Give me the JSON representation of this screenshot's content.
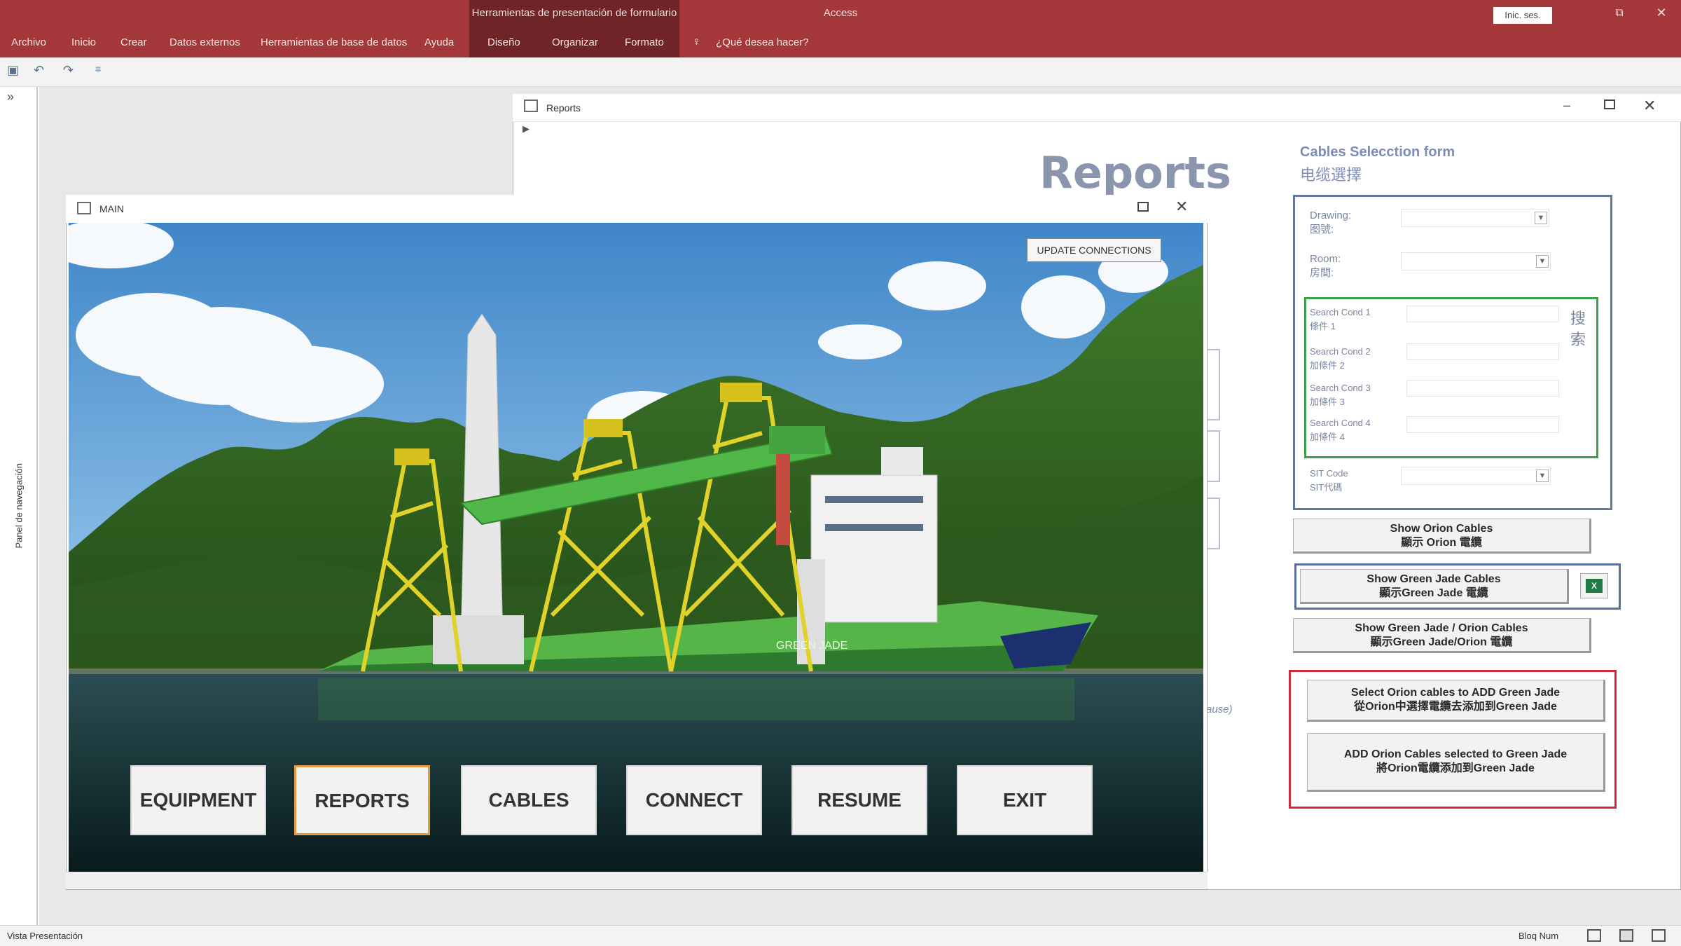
{
  "ribbon": {
    "context_header": "Herramientas de presentación de formulario",
    "app_title": "Access",
    "signin_label": "Inic. ses.",
    "tabs": [
      "Archivo",
      "Inicio",
      "Crear",
      "Datos externos",
      "Herramientas de base de datos",
      "Ayuda",
      "Diseño",
      "Organizar",
      "Formato"
    ],
    "tell_me": "¿Qué desea hacer?"
  },
  "nav_pane": {
    "label": "Panel de navegación",
    "toggle": "»"
  },
  "reports_window": {
    "title": "Reports",
    "heading": "Reports",
    "form_title": "Cables Selecction form",
    "form_title_zh": "电缆選擇",
    "drawing_label": "Drawing:",
    "drawing_label_zh": "图號:",
    "room_label": "Room:",
    "room_label_zh": "房間:",
    "search_labels": [
      "Search Cond 1",
      "Search Cond 2",
      "Search Cond 3",
      "Search Cond 4"
    ],
    "search_labels_zh": [
      "條件 1",
      "加條件 2",
      "加條件 3",
      "加條件 4"
    ],
    "search_button": "搜\n索",
    "sit_code_label": "SIT Code",
    "sit_code_label_zh": "SIT代碼",
    "btn_orion": [
      "Show Orion Cables",
      "顯示 Orion 電纜"
    ],
    "btn_green_jade": [
      "Show Green Jade Cables",
      "顯示Green Jade 電纜"
    ],
    "btn_both": [
      "Show Green Jade / Orion Cables",
      "顯示Green Jade/Orion 電纜"
    ],
    "btn_select_orion": [
      "Select Orion cables to ADD Green Jade",
      "從Orion中選擇電纜去添加到Green Jade"
    ],
    "btn_add_orion": [
      "ADD Orion Cables selected to Green Jade",
      "將Orion電纜添加到Green Jade"
    ],
    "excel_icon": "excel-icon",
    "italic_fragment": "ause)"
  },
  "main_window": {
    "title": "MAIN",
    "update_button": "UPDATE CONNECTIONS",
    "buttons": [
      "EQUIPMENT",
      "REPORTS",
      "CABLES",
      "CONNECT",
      "RESUME",
      "EXIT"
    ],
    "ship_name": "GREEN JADE",
    "active_button": "REPORTS",
    "highlight_color": "#e79a3c"
  },
  "statusbar": {
    "left": "Vista Presentación",
    "right": "Bloq Num"
  },
  "colors": {
    "ribbon": "#a4373a",
    "context": "#6f2527",
    "green_frame": "#3aa049",
    "red_frame": "#cf2b3a",
    "blue_frame": "#64799a"
  }
}
